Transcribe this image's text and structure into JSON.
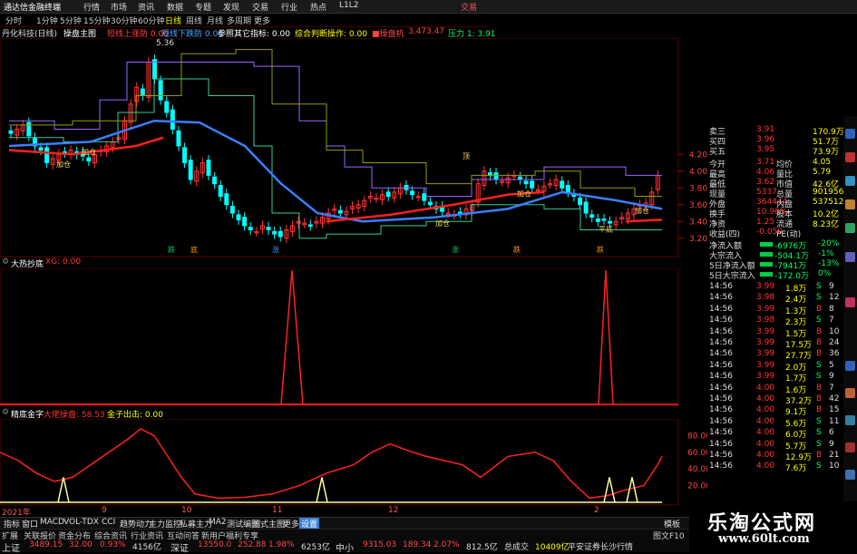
{
  "app": {
    "title": "通达信金融终端",
    "menu": [
      "行情",
      "市场",
      "资讯",
      "数据",
      "专题",
      "发现",
      "交易",
      "行业",
      "热点",
      "L1L2"
    ],
    "top_right": "交易"
  },
  "toolbar": {
    "items": [
      "分时",
      "1分钟",
      "5分钟",
      "15分钟",
      "30分钟",
      "60分钟",
      "日线",
      "周线",
      "月线",
      "多周期",
      "更多"
    ],
    "active_index": 6
  },
  "indicator_line": {
    "stock": "丹化科技(日线)",
    "main": "操盘主图",
    "l1": "短线上涨防 0.00",
    "l2": "短线下跌防 0.00",
    "l3": "参照其它指标: 0.00",
    "l4": "综合判断操作: 0.00",
    "l5": "■操盘机",
    "l6": "3.47",
    "l7": "3.47",
    "l8": "压力 1: 3.91"
  },
  "main_chart": {
    "high_label": "5.36",
    "price_ticks": [
      "4.20",
      "4.00",
      "3.80",
      "3.60",
      "3.40",
      "3.20"
    ],
    "annotations": [
      "加仓",
      "加仓",
      "顶",
      "加仓",
      "加仓",
      "加仓",
      "平底"
    ],
    "markers": [
      "跌",
      "底",
      "涨",
      "涨",
      "跌",
      "跌"
    ]
  },
  "panel2": {
    "title": "大热抄底",
    "value": "XG: 0.00"
  },
  "panel3": {
    "title": "精底金字",
    "l1": "大佬操盘: 58.53",
    "l2": "金子出击: 0.00",
    "ticks": [
      "80.00",
      "60.00",
      "40.00",
      "20.00"
    ]
  },
  "x_axis": [
    "2021年",
    "9",
    "10",
    "11",
    "12",
    "2"
  ],
  "right_panel": {
    "quotes": [
      {
        "label": "卖三",
        "price": "3.91",
        "vol": "170.9万"
      },
      {
        "label": "买四",
        "price": "3.96",
        "vol": "51.7万"
      },
      {
        "label": "买五",
        "price": "3.95",
        "vol": "73.9万"
      }
    ],
    "stats": [
      {
        "l1": "今开",
        "v1": "3.71",
        "l2": "均价",
        "v2": "4.05"
      },
      {
        "l1": "最高",
        "v1": "4.06",
        "l2": "量比",
        "v2": "5.79"
      },
      {
        "l1": "最低",
        "v1": "3.62",
        "l2": "市值",
        "v2": "42.6亿"
      },
      {
        "l1": "现量",
        "v1": "5337",
        "l2": "总量",
        "v2": "901956"
      },
      {
        "l1": "外盘",
        "v1": "364444",
        "l2": "内盘",
        "v2": "537512"
      },
      {
        "l1": "换手",
        "v1": "10.96%",
        "l2": "股本",
        "v2": "10.2亿"
      },
      {
        "l1": "净资",
        "v1": "1.25",
        "l2": "流通",
        "v2": "8.23亿"
      },
      {
        "l1": "收益(四)",
        "v1": "-0.050",
        "l2": "PE(动)",
        "v2": ""
      }
    ],
    "flows": [
      {
        "label": "净流入额",
        "v": "-6976万",
        "p": "-20%"
      },
      {
        "label": "大宗流入",
        "v": "-504.1万",
        "p": "-1%"
      },
      {
        "label": "5日净流入额",
        "v": "-7941万",
        "p": "-13%"
      },
      {
        "label": "5日大宗流入",
        "v": "-172.0万",
        "p": "0%"
      }
    ],
    "ticks": [
      {
        "t": "14:56",
        "p": "3.99",
        "v": "1.8万",
        "bs": "S",
        "n": "9"
      },
      {
        "t": "14:56",
        "p": "3.98",
        "v": "2.4万",
        "bs": "S",
        "n": "12"
      },
      {
        "t": "14:56",
        "p": "3.99",
        "v": "1.3万",
        "bs": "B",
        "n": "8"
      },
      {
        "t": "14:56",
        "p": "3.98",
        "v": "2.3万",
        "bs": "S",
        "n": "7"
      },
      {
        "t": "14:56",
        "p": "3.99",
        "v": "1.5万",
        "bs": "B",
        "n": "10"
      },
      {
        "t": "14:56",
        "p": "3.99",
        "v": "17.5万",
        "bs": "B",
        "n": "24"
      },
      {
        "t": "14:56",
        "p": "3.99",
        "v": "27.7万",
        "bs": "B",
        "n": "36"
      },
      {
        "t": "14:56",
        "p": "3.99",
        "v": "2.0万",
        "bs": "S",
        "n": "5"
      },
      {
        "t": "14:56",
        "p": "3.99",
        "v": "1.7万",
        "bs": "S",
        "n": "9"
      },
      {
        "t": "14:56",
        "p": "4.00",
        "v": "1.6万",
        "bs": "B",
        "n": "7"
      },
      {
        "t": "14:56",
        "p": "4.00",
        "v": "37.2万",
        "bs": "B",
        "n": "42"
      },
      {
        "t": "14:56",
        "p": "4.00",
        "v": "9.1万",
        "bs": "B",
        "n": "15"
      },
      {
        "t": "14:56",
        "p": "4.00",
        "v": "5.6万",
        "bs": "S",
        "n": "11"
      },
      {
        "t": "14:56",
        "p": "4.00",
        "v": "6.0万",
        "bs": "S",
        "n": "6"
      },
      {
        "t": "14:56",
        "p": "4.00",
        "v": "5.7万",
        "bs": "S",
        "n": "9"
      },
      {
        "t": "14:56",
        "p": "4.00",
        "v": "12.9万",
        "bs": "B",
        "n": "21"
      },
      {
        "t": "14:56",
        "p": "4.00",
        "v": "7.6万",
        "bs": "S",
        "n": "10"
      }
    ]
  },
  "tabs": [
    "指标",
    "窗口",
    "MACD",
    "VOL-TDX",
    "CCI",
    "趋势动力",
    "主力监控",
    "私募主力",
    "MA2",
    "测试编图",
    "测式主图",
    "更多",
    "设置"
  ],
  "tab_selected": 12,
  "tab_right": "模板",
  "statusbar1": [
    "扩展",
    "关联报价",
    "资金分布",
    "综合资讯",
    "行业资讯",
    "互动问答",
    "新用户福利专享"
  ],
  "statusbar1_right": "图文F10",
  "statusbar2": {
    "items": [
      {
        "label": "上证",
        "v1": "3489.15",
        "v2": "32.00",
        "v3": "0.93%",
        "v4": "4156亿"
      },
      {
        "label": "深证",
        "v1": "13550.0",
        "v2": "252.88",
        "v3": "1.98%",
        "v4": "6253亿"
      },
      {
        "label": "中小",
        "v1": "9315.03",
        "v2": "189.34",
        "v3": "2.07%",
        "v4": "812.5亿"
      }
    ],
    "total_label": "总成交",
    "total": "10409亿",
    "broker": "平安证券长沙行情"
  },
  "watermark": {
    "line1": "乐淘公式网",
    "line2": "www.60lt.com"
  },
  "colors": {
    "up": "#ff3333",
    "down": "#00ffff",
    "ma_red": "#ff2020",
    "ma_blue": "#3a7fff",
    "yellow": "#ffff00",
    "grid": "#5a0000",
    "magenta": "#ff33ff",
    "green": "#00ff66"
  }
}
